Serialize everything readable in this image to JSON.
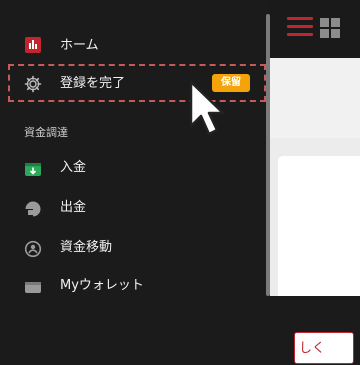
{
  "menu": {
    "home": "ホーム",
    "complete_registration": "登録を完了",
    "badge": "保留",
    "section_funds": "資金調達",
    "deposit": "入金",
    "withdraw": "出金",
    "transfer": "資金移動",
    "wallet": "Myウォレット"
  },
  "background": {
    "partial_button": "しく"
  },
  "colors": {
    "accent": "#c0262d",
    "badge": "#f5a30b",
    "deposit_icon": "#2ba85a"
  }
}
